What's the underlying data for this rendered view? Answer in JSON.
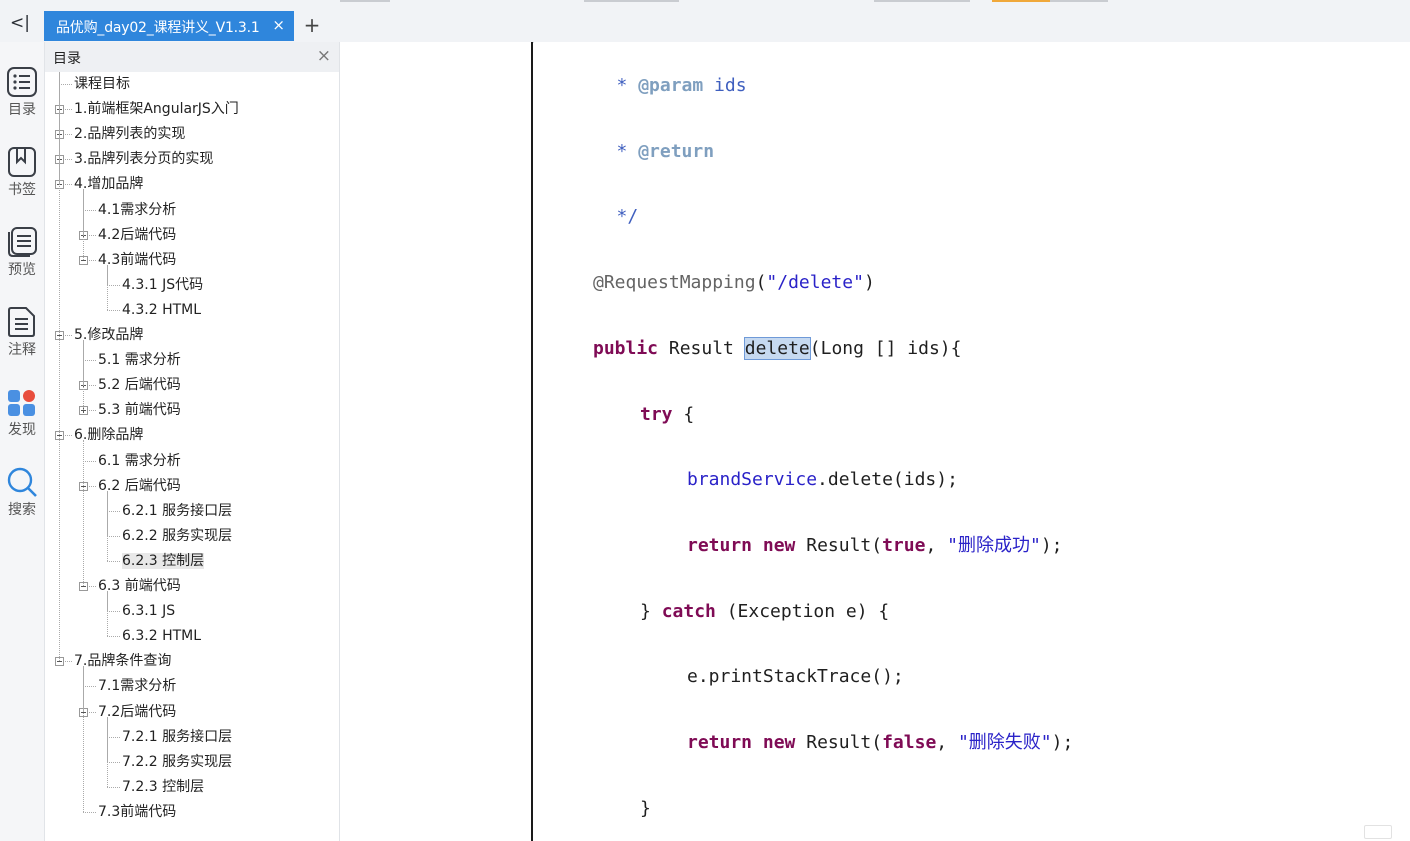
{
  "tabbar": {
    "collapse_glyph": "<|",
    "tab_label": "品优购_day02_课程讲义_V1.3.1",
    "tab_close": "×",
    "new_tab": "+"
  },
  "rail": [
    {
      "label": "目录",
      "icon": "toc-icon"
    },
    {
      "label": "书签",
      "icon": "bookmark-icon"
    },
    {
      "label": "预览",
      "icon": "preview-icon"
    },
    {
      "label": "注释",
      "icon": "annotation-icon"
    },
    {
      "label": "发现",
      "icon": "discover-icon"
    },
    {
      "label": "搜索",
      "icon": "search-icon"
    }
  ],
  "toc": {
    "title": "目录",
    "close": "×",
    "items": [
      {
        "label": "课程目标",
        "level": 0,
        "toggle": "none"
      },
      {
        "label": "1.前端框架AngularJS入门",
        "level": 0,
        "toggle": "plus"
      },
      {
        "label": "2.品牌列表的实现",
        "level": 0,
        "toggle": "plus"
      },
      {
        "label": "3.品牌列表分页的实现",
        "level": 0,
        "toggle": "plus"
      },
      {
        "label": "4.增加品牌",
        "level": 0,
        "toggle": "minus"
      },
      {
        "label": "4.1需求分析",
        "level": 1,
        "toggle": "none"
      },
      {
        "label": "4.2后端代码",
        "level": 1,
        "toggle": "plus"
      },
      {
        "label": "4.3前端代码",
        "level": 1,
        "toggle": "minus"
      },
      {
        "label": "4.3.1 JS代码",
        "level": 2,
        "toggle": "none"
      },
      {
        "label": "4.3.2 HTML",
        "level": 2,
        "toggle": "none"
      },
      {
        "label": "5.修改品牌",
        "level": 0,
        "toggle": "minus"
      },
      {
        "label": "5.1 需求分析",
        "level": 1,
        "toggle": "none"
      },
      {
        "label": "5.2 后端代码",
        "level": 1,
        "toggle": "plus"
      },
      {
        "label": "5.3 前端代码",
        "level": 1,
        "toggle": "plus"
      },
      {
        "label": "6.删除品牌",
        "level": 0,
        "toggle": "minus"
      },
      {
        "label": "6.1 需求分析",
        "level": 1,
        "toggle": "none"
      },
      {
        "label": "6.2 后端代码",
        "level": 1,
        "toggle": "minus"
      },
      {
        "label": "6.2.1 服务接口层",
        "level": 2,
        "toggle": "none"
      },
      {
        "label": "6.2.2 服务实现层",
        "level": 2,
        "toggle": "none"
      },
      {
        "label": "6.2.3 控制层",
        "level": 2,
        "toggle": "none",
        "selected": true
      },
      {
        "label": "6.3 前端代码",
        "level": 1,
        "toggle": "minus"
      },
      {
        "label": "6.3.1 JS",
        "level": 2,
        "toggle": "none"
      },
      {
        "label": "6.3.2 HTML",
        "level": 2,
        "toggle": "none"
      },
      {
        "label": "7.品牌条件查询",
        "level": 0,
        "toggle": "minus"
      },
      {
        "label": "7.1需求分析",
        "level": 1,
        "toggle": "none"
      },
      {
        "label": "7.2后端代码",
        "level": 1,
        "toggle": "minus"
      },
      {
        "label": "7.2.1 服务接口层",
        "level": 2,
        "toggle": "none"
      },
      {
        "label": "7.2.2 服务实现层",
        "level": 2,
        "toggle": "none"
      },
      {
        "label": "7.2.3 控制层",
        "level": 2,
        "toggle": "none"
      },
      {
        "label": "7.3前端代码",
        "level": 1,
        "toggle": "none"
      }
    ]
  },
  "code": {
    "lines": [
      {
        "indent": 1,
        "tokens": [
          {
            "t": "*",
            "c": "cm"
          },
          {
            "t": " "
          },
          {
            "t": "@param",
            "c": "tag"
          },
          {
            "t": " ids",
            "c": "cm"
          }
        ]
      },
      {
        "indent": 1,
        "tokens": [
          {
            "t": "*",
            "c": "cm"
          },
          {
            "t": " "
          },
          {
            "t": "@return",
            "c": "tag"
          }
        ]
      },
      {
        "indent": 1,
        "tokens": [
          {
            "t": "*/",
            "c": "cm"
          }
        ]
      },
      {
        "indent": 0,
        "tokens": [
          {
            "t": "@RequestMapping",
            "c": "ann"
          },
          {
            "t": "("
          },
          {
            "t": "\"/delete\"",
            "c": "str"
          },
          {
            "t": ")"
          }
        ]
      },
      {
        "indent": 0,
        "tokens": [
          {
            "t": "public",
            "c": "kw"
          },
          {
            "t": " Result "
          },
          {
            "t": "delete",
            "c": "hlw"
          },
          {
            "t": "(Long [] ids){"
          }
        ]
      },
      {
        "indent": 2,
        "tokens": [
          {
            "t": "try",
            "c": "kw"
          },
          {
            "t": " {"
          }
        ]
      },
      {
        "indent": 4,
        "tokens": [
          {
            "t": "brandService",
            "c": "str"
          },
          {
            "t": ".delete(ids);"
          }
        ]
      },
      {
        "indent": 4,
        "tokens": [
          {
            "t": "return",
            "c": "kw"
          },
          {
            "t": " "
          },
          {
            "t": "new",
            "c": "kw"
          },
          {
            "t": " Result("
          },
          {
            "t": "true",
            "c": "kw"
          },
          {
            "t": ", "
          },
          {
            "t": "\"删除成功\"",
            "c": "str"
          },
          {
            "t": ");"
          }
        ]
      },
      {
        "indent": 2,
        "tokens": [
          {
            "t": "} "
          },
          {
            "t": "catch",
            "c": "kw"
          },
          {
            "t": " (Exception e) {"
          }
        ]
      },
      {
        "indent": 4,
        "tokens": [
          {
            "t": "e.printStackTrace();"
          }
        ]
      },
      {
        "indent": 4,
        "tokens": [
          {
            "t": "return",
            "c": "kw"
          },
          {
            "t": " "
          },
          {
            "t": "new",
            "c": "kw"
          },
          {
            "t": " Result("
          },
          {
            "t": "false",
            "c": "kw"
          },
          {
            "t": ", "
          },
          {
            "t": "\"删除失败\"",
            "c": "str"
          },
          {
            "t": ");"
          }
        ]
      },
      {
        "indent": 2,
        "tokens": [
          {
            "t": "}"
          }
        ]
      }
    ]
  }
}
